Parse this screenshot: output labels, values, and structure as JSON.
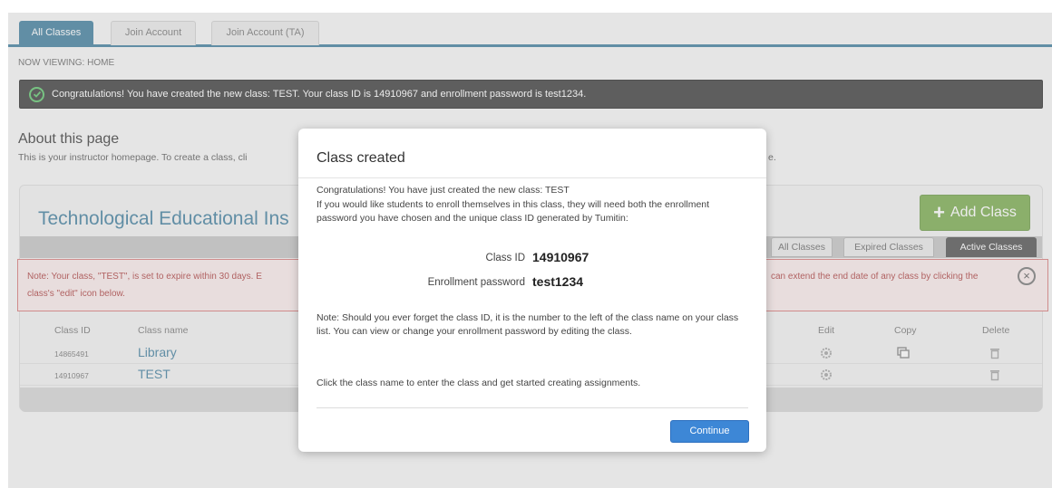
{
  "tabs": [
    {
      "label": "All Classes"
    },
    {
      "label": "Join Account"
    },
    {
      "label": "Join Account (TA)"
    }
  ],
  "breadcrumb": "NOW VIEWING: HOME",
  "success_banner": "Congratulations! You have created the new class: TEST. Your class ID is 14910967 and enrollment password is test1234.",
  "about": {
    "heading": "About this page",
    "text_left": "This is your instructor homepage. To create a class, cli",
    "text_right": "e."
  },
  "panel": {
    "institution": "Technological Educational Ins",
    "add_class_label": "Add Class",
    "filters": [
      "All Classes",
      "Expired Classes",
      "Active Classes"
    ],
    "note_line1": "Note: Your class, \"TEST\", is set to expire within 30 days. E",
    "note_line2": "class's \"edit\" icon below.",
    "note_line3": "can extend the end date of any class by clicking the",
    "columns": {
      "id": "Class ID",
      "name": "Class name",
      "edit": "Edit",
      "copy": "Copy",
      "delete": "Delete"
    },
    "rows": [
      {
        "id": "14865491",
        "name": "Library"
      },
      {
        "id": "14910967",
        "name": "TEST"
      }
    ]
  },
  "modal": {
    "title": "Class created",
    "p1": "Congratulations! You have just created the new class: TEST",
    "p2": "If you would like students to enroll themselves in this class, they will need both the enrollment password you have chosen and the unique class ID generated by Tumitin:",
    "class_id_label": "Class ID",
    "class_id_value": "14910967",
    "password_label": "Enrollment password",
    "password_value": "test1234",
    "p3": "Note: Should you ever forget the class ID, it is the number to the left of the class name on your class list. You can view or change your enrollment password by editing the class.",
    "p4": "Click the class name to enter the class and get started creating assignments.",
    "continue_label": "Continue"
  },
  "colors": {
    "accent": "#2a6f93",
    "add_button": "#6aa13a",
    "continue_button": "#3d87d6",
    "note_text": "#a42a2a"
  }
}
